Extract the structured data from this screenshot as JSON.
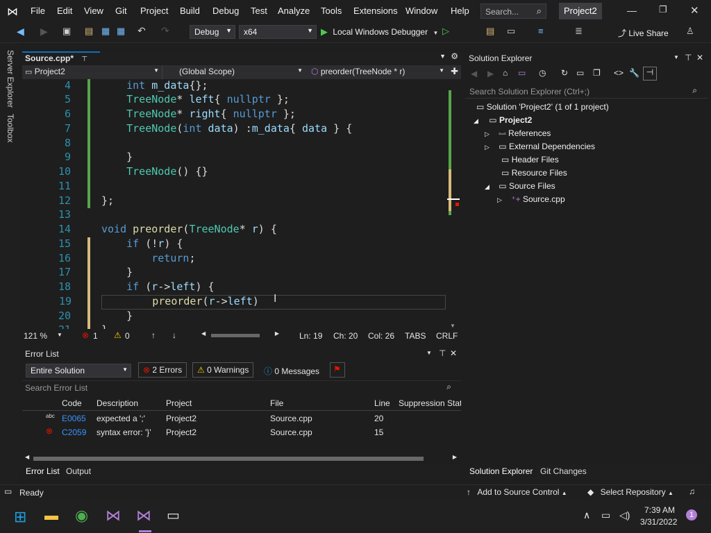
{
  "menu": [
    "File",
    "Edit",
    "View",
    "Git",
    "Project",
    "Build",
    "Debug",
    "Test",
    "Analyze",
    "Tools",
    "Extensions",
    "Window",
    "Help"
  ],
  "search": {
    "placeholder": "Search..."
  },
  "title": {
    "project": "Project2"
  },
  "toolbar": {
    "config": "Debug",
    "platform": "x64",
    "run_label": "Local Windows Debugger",
    "live_share": "Live Share"
  },
  "left_rail": {
    "server_explorer": "Server Explorer",
    "toolbox": "Toolbox"
  },
  "editor": {
    "tab": "Source.cpp*",
    "project_dd": "Project2",
    "scope_dd": "(Global Scope)",
    "member_dd": "preorder(TreeNode * r)",
    "lines": [
      {
        "n": "4",
        "t": "    int m_data{};"
      },
      {
        "n": "5",
        "t": "    TreeNode* left{ nullptr };"
      },
      {
        "n": "6",
        "t": "    TreeNode* right{ nullptr };"
      },
      {
        "n": "7",
        "t": "    TreeNode(int data) :m_data{ data } {"
      },
      {
        "n": "8",
        "t": ""
      },
      {
        "n": "9",
        "t": "    }"
      },
      {
        "n": "10",
        "t": "    TreeNode() {}"
      },
      {
        "n": "11",
        "t": ""
      },
      {
        "n": "12",
        "t": "};"
      },
      {
        "n": "13",
        "t": ""
      },
      {
        "n": "14",
        "t": "void preorder(TreeNode* r) {"
      },
      {
        "n": "15",
        "t": "    if (!r) {"
      },
      {
        "n": "16",
        "t": "        return;"
      },
      {
        "n": "17",
        "t": "    }"
      },
      {
        "n": "18",
        "t": "    if (r->left) {"
      },
      {
        "n": "19",
        "t": "        preorder(r->left)"
      },
      {
        "n": "20",
        "t": "    }"
      },
      {
        "n": "21",
        "t": "}"
      }
    ],
    "zoom": "121 %",
    "err_count": "1",
    "warn_count": "0",
    "ln": "Ln: 19",
    "ch": "Ch: 20",
    "col": "Col: 26",
    "tabs": "TABS",
    "crlf": "CRLF"
  },
  "error_list": {
    "title": "Error List",
    "scope": "Entire Solution",
    "errors": "2 Errors",
    "warnings": "0 Warnings",
    "messages": "0 Messages",
    "search_placeholder": "Search Error List",
    "columns": [
      "Code",
      "Description",
      "Project",
      "File",
      "Line",
      "Suppression State"
    ],
    "rows": [
      {
        "code": "E0065",
        "desc": "expected a ';'",
        "project": "Project2",
        "file": "Source.cpp",
        "line": "20"
      },
      {
        "code": "C2059",
        "desc": "syntax error: '}'",
        "project": "Project2",
        "file": "Source.cpp",
        "line": "15"
      }
    ],
    "tabs": [
      "Error List",
      "Output"
    ]
  },
  "solution_explorer": {
    "title": "Solution Explorer",
    "search_placeholder": "Search Solution Explorer (Ctrl+;)",
    "solution": "Solution 'Project2' (1 of 1 project)",
    "project": "Project2",
    "items": [
      "References",
      "External Dependencies",
      "Header Files",
      "Resource Files",
      "Source Files"
    ],
    "source_file": "Source.cpp",
    "tabs": [
      "Solution Explorer",
      "Git Changes"
    ]
  },
  "status": {
    "ready": "Ready",
    "add_source": "Add to Source Control",
    "select_repo": "Select Repository"
  },
  "taskbar": {
    "time": "7:39 AM",
    "date": "3/31/2022",
    "notif": "1"
  }
}
